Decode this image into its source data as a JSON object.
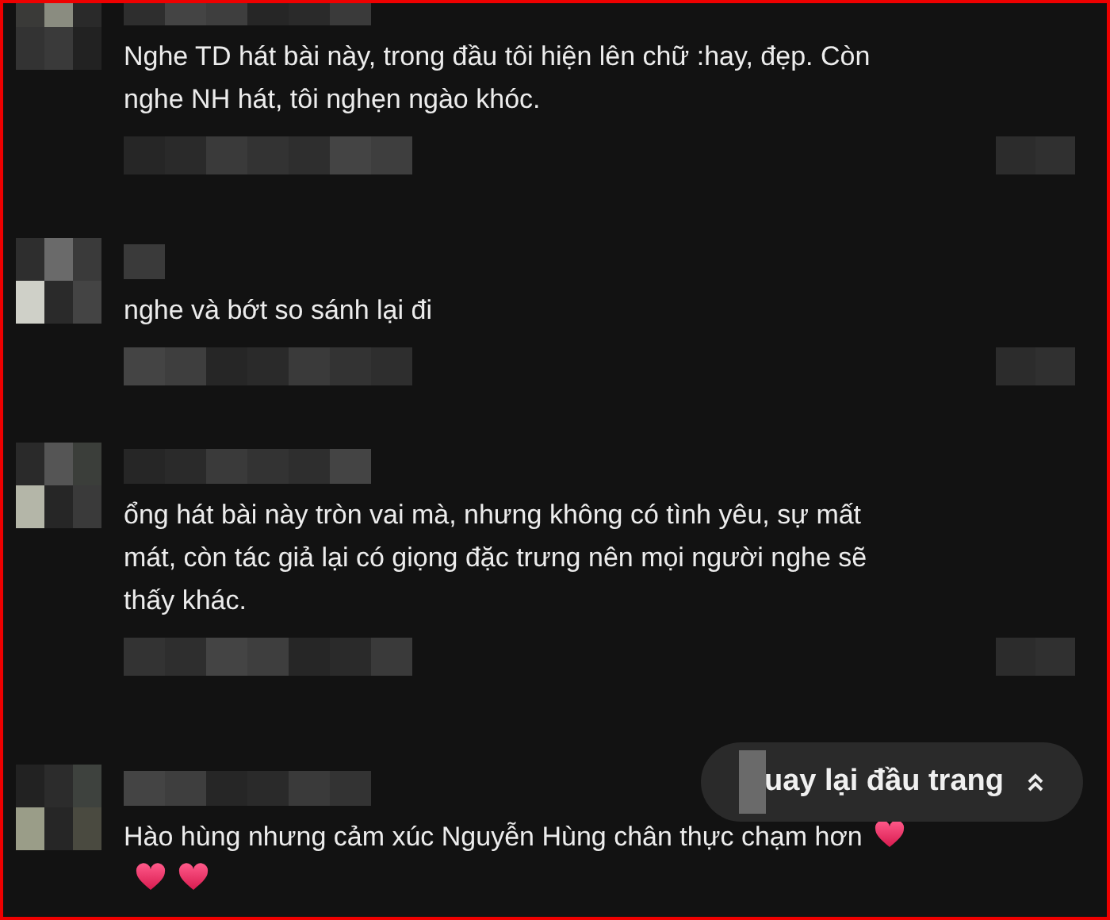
{
  "comments": [
    {
      "text": "Nghe TD hát bài này, trong đầu tôi hiện lên chữ :hay, đẹp. Còn nghe NH hát, tôi nghẹn ngào khóc."
    },
    {
      "text": "nghe và bớt so sánh lại đi"
    },
    {
      "text": "ổng hát bài này tròn vai mà, nhưng không có tình yêu, sự mất mát, còn tác giả lại có giọng đặc trưng nên mọi người nghe sẽ thấy khác."
    },
    {
      "text": "Hào hùng nhưng cảm xúc Nguyễn Hùng chân thực chạm hơn",
      "emojis": [
        {
          "kind": "heart"
        },
        {
          "kind": "heart"
        },
        {
          "kind": "heart"
        }
      ]
    }
  ],
  "back_to_top": {
    "label": "uay lại đầu trang"
  }
}
